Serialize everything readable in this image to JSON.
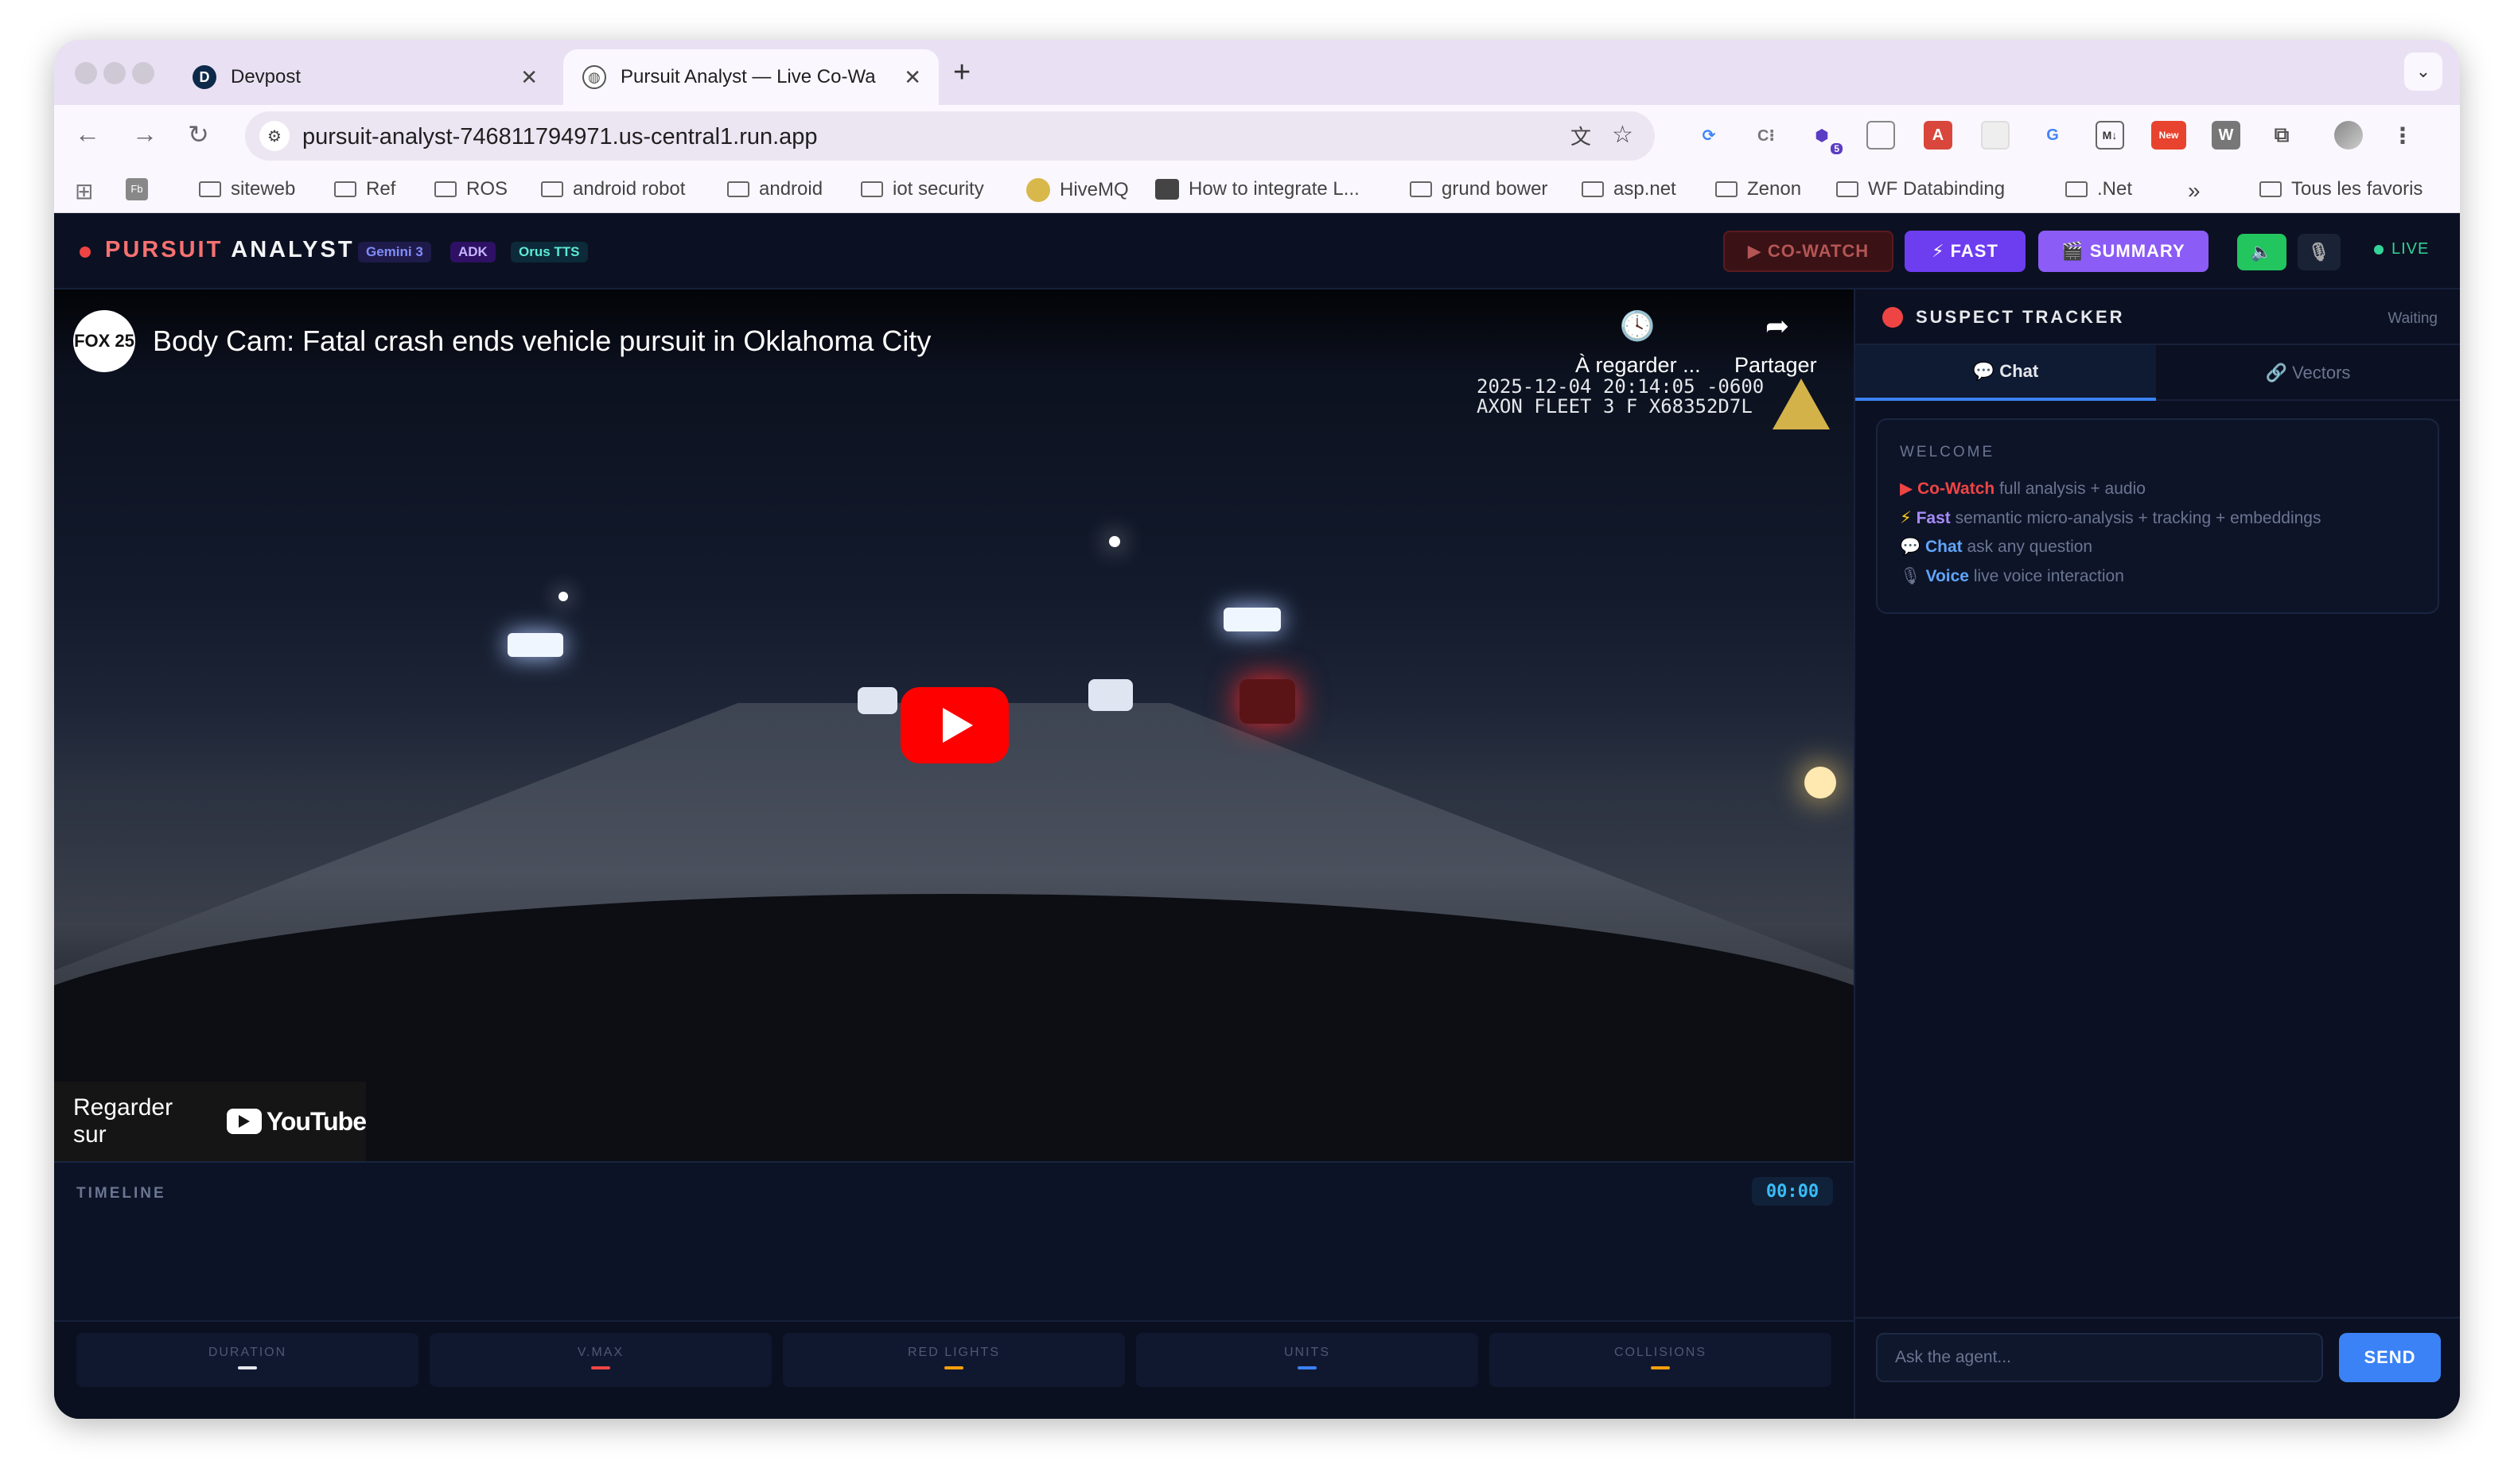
{
  "browser": {
    "tabs": [
      {
        "title": "Devpost",
        "favicon": "D"
      },
      {
        "title": "Pursuit Analyst — Live Co-Wa",
        "favicon": "globe"
      }
    ],
    "url": "pursuit-analyst-746811794971.us-central1.run.app",
    "extensions_badge": "5",
    "new_badge": "New",
    "bookmarks": [
      {
        "label": "siteweb"
      },
      {
        "label": "Ref"
      },
      {
        "label": "ROS"
      },
      {
        "label": "android robot"
      },
      {
        "label": "android"
      },
      {
        "label": "iot security"
      },
      {
        "label": "HiveMQ"
      },
      {
        "label": "How to integrate L..."
      },
      {
        "label": "grund bower"
      },
      {
        "label": "asp.net"
      },
      {
        "label": "Zenon"
      },
      {
        "label": "WF Databinding"
      },
      {
        "label": ".Net"
      }
    ],
    "bookmarks_more": "»",
    "all_bookmarks": "Tous les favoris"
  },
  "app": {
    "brand_part1": "PURSUIT",
    "brand_part2": "ANALYST",
    "chips": [
      "Gemini 3",
      "ADK",
      "Orus TTS"
    ],
    "buttons": {
      "cowatch": "▶ CO-WATCH",
      "fast": "⚡ FAST",
      "summary": "🎬 SUMMARY",
      "speaker": "🔈",
      "mic": "🎙"
    },
    "live_label": "LIVE"
  },
  "video": {
    "channel_logo": "FOX 25",
    "title": "Body Cam: Fatal crash ends vehicle pursuit in Oklahoma City",
    "watch_later": "À regarder ...",
    "share": "Partager",
    "overlay_line1": "2025-12-04 20:14:05 -0600",
    "overlay_line2": "AXON FLEET 3 F X68352D7L",
    "watch_on": "Regarder sur",
    "youtube": "YouTube"
  },
  "timeline": {
    "label": "TIMELINE",
    "time": "00:00"
  },
  "stats": [
    {
      "label": "DURATION",
      "value": "—",
      "color": "#e5e7eb"
    },
    {
      "label": "V.MAX",
      "value": "—",
      "color": "#ef4444"
    },
    {
      "label": "RED LIGHTS",
      "value": "—",
      "color": "#f59e0b"
    },
    {
      "label": "UNITS",
      "value": "—",
      "color": "#3b82f6"
    },
    {
      "label": "COLLISIONS",
      "value": "—",
      "color": "#f59e0b"
    }
  ],
  "side": {
    "title": "SUSPECT TRACKER",
    "status": "Waiting",
    "tabs": {
      "chat": "💬 Chat",
      "vectors": "🔗 Vectors"
    },
    "welcome_title": "WELCOME",
    "welcome_lines": [
      {
        "icon": "▶",
        "name": "Co-Watch",
        "desc": " full analysis + audio",
        "color": "#ef4444"
      },
      {
        "icon": "⚡",
        "name": "Fast",
        "desc": " semantic micro-analysis + tracking + embeddings",
        "color": "#a78bfa"
      },
      {
        "icon": "💬",
        "name": "Chat",
        "desc": " ask any question",
        "color": "#60a5fa"
      },
      {
        "icon": "🎙",
        "name": "Voice",
        "desc": " live voice interaction",
        "color": "#60a5fa"
      }
    ],
    "input_placeholder": "Ask the agent...",
    "send": "SEND"
  }
}
